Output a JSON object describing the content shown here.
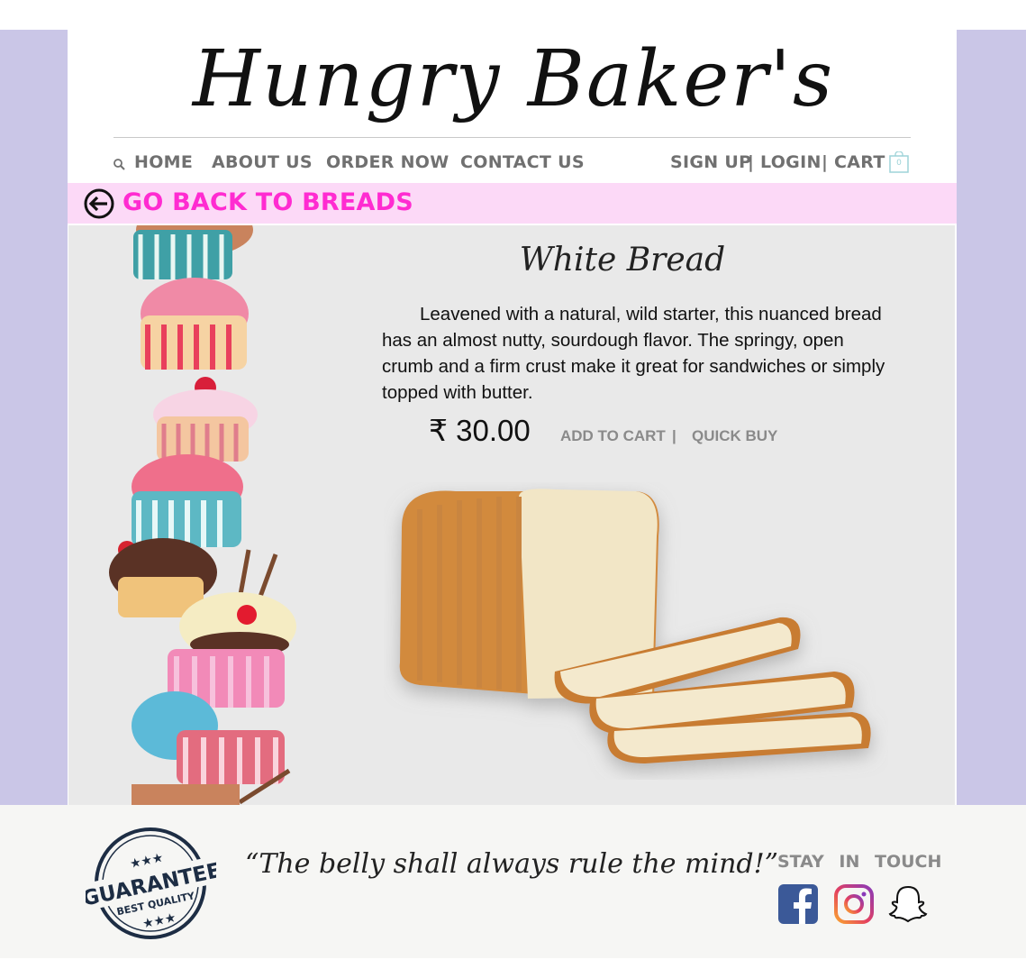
{
  "brand": {
    "logo_text": "Hungry Baker's"
  },
  "nav": {
    "home": "HOME",
    "about": "ABOUT US",
    "order": "ORDER NOW",
    "contact": "CONTACT US",
    "signup": "SIGN UP",
    "login": "LOGIN",
    "cart": "CART",
    "cart_count": "0",
    "separator": "|"
  },
  "back": {
    "label": "GO BACK TO BREADS"
  },
  "product": {
    "title": "White Bread",
    "description": "Leavened with a natural, wild starter, this nuanced bread has an almost nutty, sourdough flavor. The springy, open crumb and a firm crust make it great for sandwiches or simply topped with butter.",
    "price": "₹ 30.00",
    "add_to_cart": "ADD TO CART",
    "separator": "|",
    "quick_buy": "QUICK BUY"
  },
  "footer": {
    "stamp_top": "GUARANTEE",
    "stamp_bottom": "BEST QUALITY",
    "quote": "“The belly shall always rule the mind!”",
    "stay_in_touch": "STAY IN TOUCH",
    "social": [
      "facebook-icon",
      "instagram-icon",
      "snapchat-icon"
    ]
  },
  "colors": {
    "side_panel": "#cac6e7",
    "back_bar": "#fcd9f7",
    "back_text": "#ff2bd1",
    "content_bg": "#e9e9e9",
    "footer_bg": "#f6f6f4",
    "facebook": "#3b5998"
  }
}
